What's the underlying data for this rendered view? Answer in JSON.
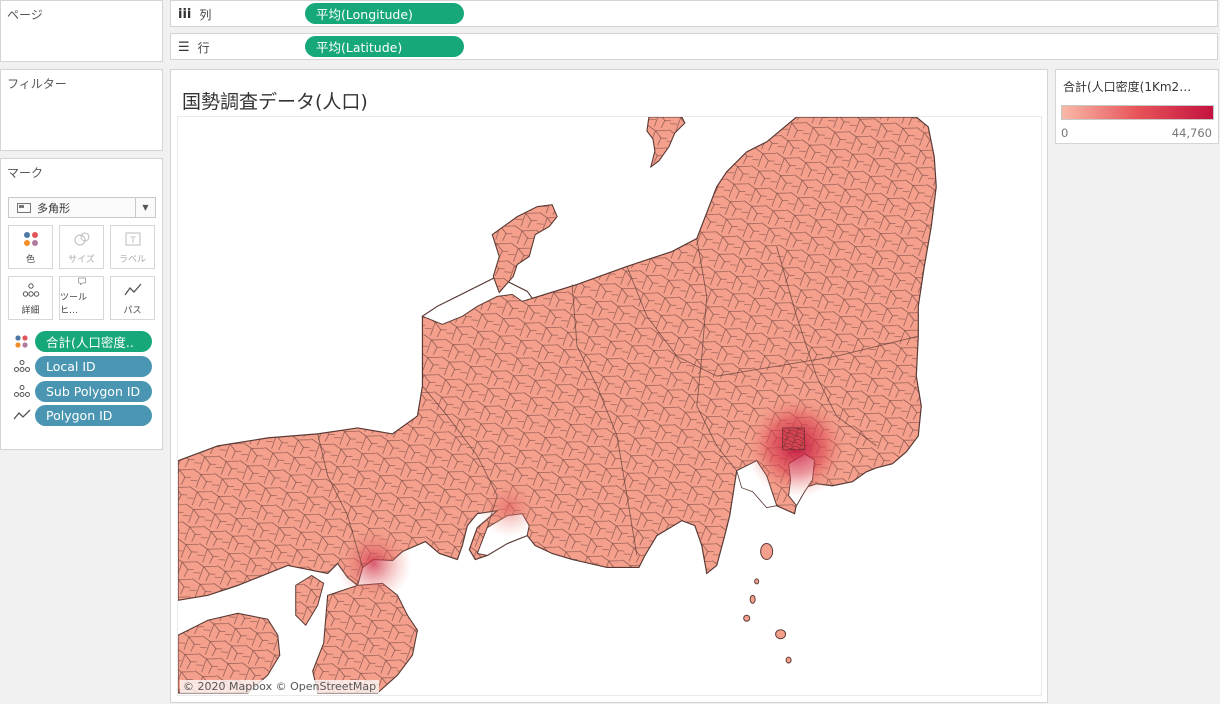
{
  "pages": {
    "title": "ページ"
  },
  "filters": {
    "title": "フィルター"
  },
  "marks": {
    "title": "マーク",
    "mark_type": "多角形",
    "buttons": [
      {
        "label": "色",
        "icon": "color-icon",
        "enabled": true
      },
      {
        "label": "サイズ",
        "icon": "size-icon",
        "enabled": false
      },
      {
        "label": "ラベル",
        "icon": "label-icon",
        "enabled": false
      },
      {
        "label": "詳細",
        "icon": "detail-icon",
        "enabled": true
      },
      {
        "label": "ツールヒ…",
        "icon": "tooltip-icon",
        "enabled": true
      },
      {
        "label": "パス",
        "icon": "path-icon",
        "enabled": true
      }
    ],
    "fields": [
      {
        "label": "合計(人口密度..",
        "type": "color",
        "pill": "green"
      },
      {
        "label": "Local ID",
        "type": "detail",
        "pill": "blue"
      },
      {
        "label": "Sub Polygon ID",
        "type": "detail",
        "pill": "blue"
      },
      {
        "label": "Polygon ID",
        "type": "path",
        "pill": "blue"
      }
    ]
  },
  "shelves": {
    "columns": {
      "label": "列",
      "pill": "平均(Longitude)"
    },
    "rows": {
      "label": "行",
      "pill": "平均(Latitude)"
    }
  },
  "sheet": {
    "title": "国勢調査データ(人口)",
    "attribution": "© 2020 Mapbox © OpenStreetMap"
  },
  "legend": {
    "title": "合計(人口密度(1Km2…",
    "min": "0",
    "max": "44,760",
    "colors": {
      "low": "#f8b9a8",
      "mid": "#e7545a",
      "high": "#c3123f"
    }
  },
  "colors": {
    "green_pill": "#16a77a",
    "blue_pill": "#4a96b2",
    "land_fill": "#f4a08c",
    "border": "#6b3e39"
  }
}
